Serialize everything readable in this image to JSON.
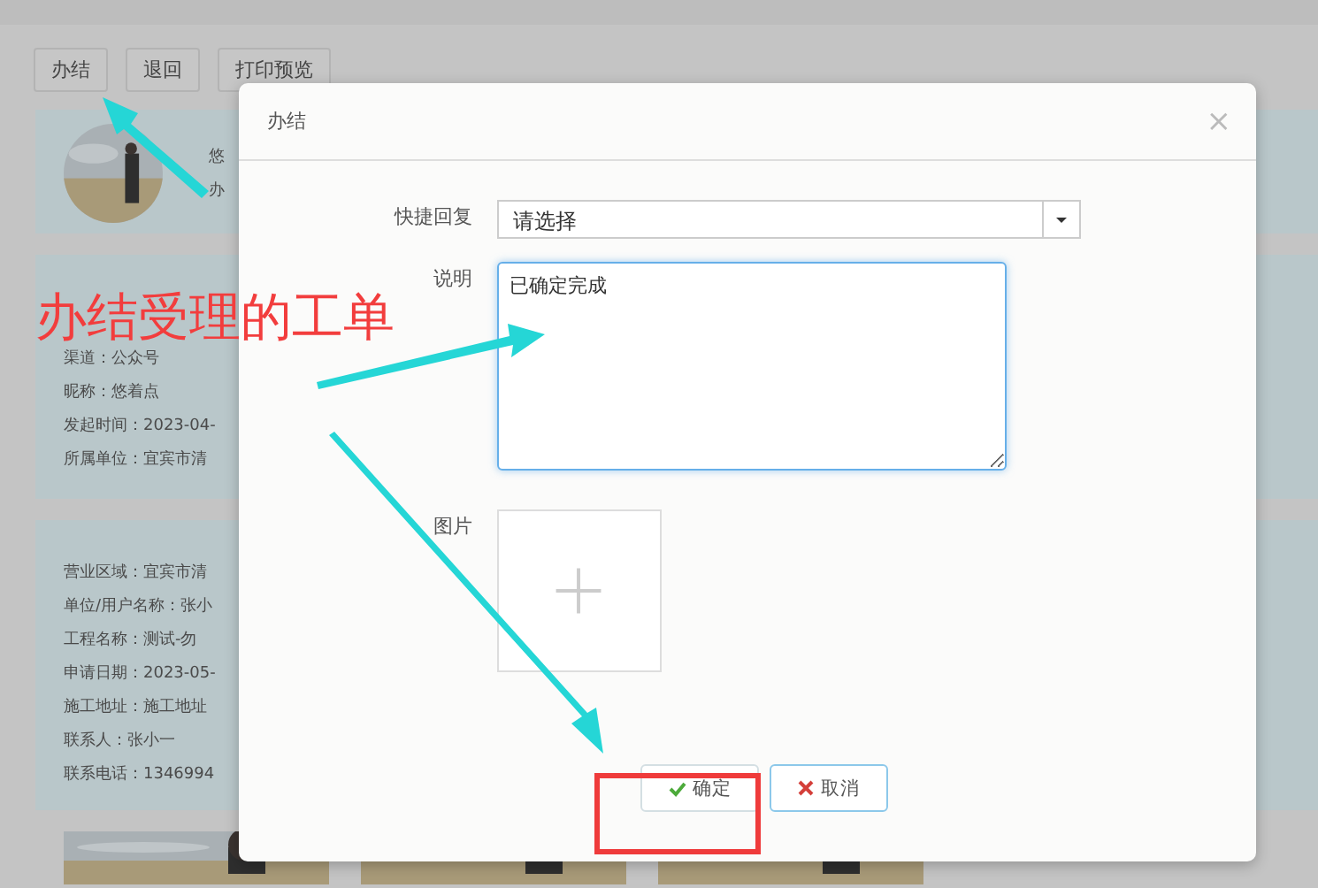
{
  "toolbar": {
    "buttons": [
      "办结",
      "退回",
      "打印预览"
    ]
  },
  "cards": [
    {
      "kind": "profile",
      "lines": [
        "悠",
        "办"
      ]
    },
    {
      "kind": "info",
      "lines": [
        "渠道：公众号",
        "昵称：悠着点",
        "发起时间：2023-04-",
        "所属单位：宜宾市清"
      ]
    },
    {
      "kind": "info",
      "lines": [
        "营业区域：宜宾市清",
        "单位/用户名称：张小",
        "工程名称：测试-勿",
        "申请日期：2023-05-",
        "施工地址：施工地址",
        "联系人：张小一",
        "联系电话：1346994"
      ]
    },
    {
      "kind": "photos"
    }
  ],
  "modal": {
    "title": "办结",
    "close": "×",
    "quick_reply": {
      "label": "快捷回复",
      "placeholder": "请选择"
    },
    "note": {
      "label": "说明",
      "value": "已确定完成"
    },
    "image": {
      "label": "图片"
    },
    "buttons": [
      {
        "kind": "ok",
        "label": "确定",
        "highlighted": true
      },
      {
        "kind": "cancel",
        "label": "取消",
        "highlighted": false
      }
    ]
  },
  "annotation": {
    "text": "办结受理的工单"
  }
}
